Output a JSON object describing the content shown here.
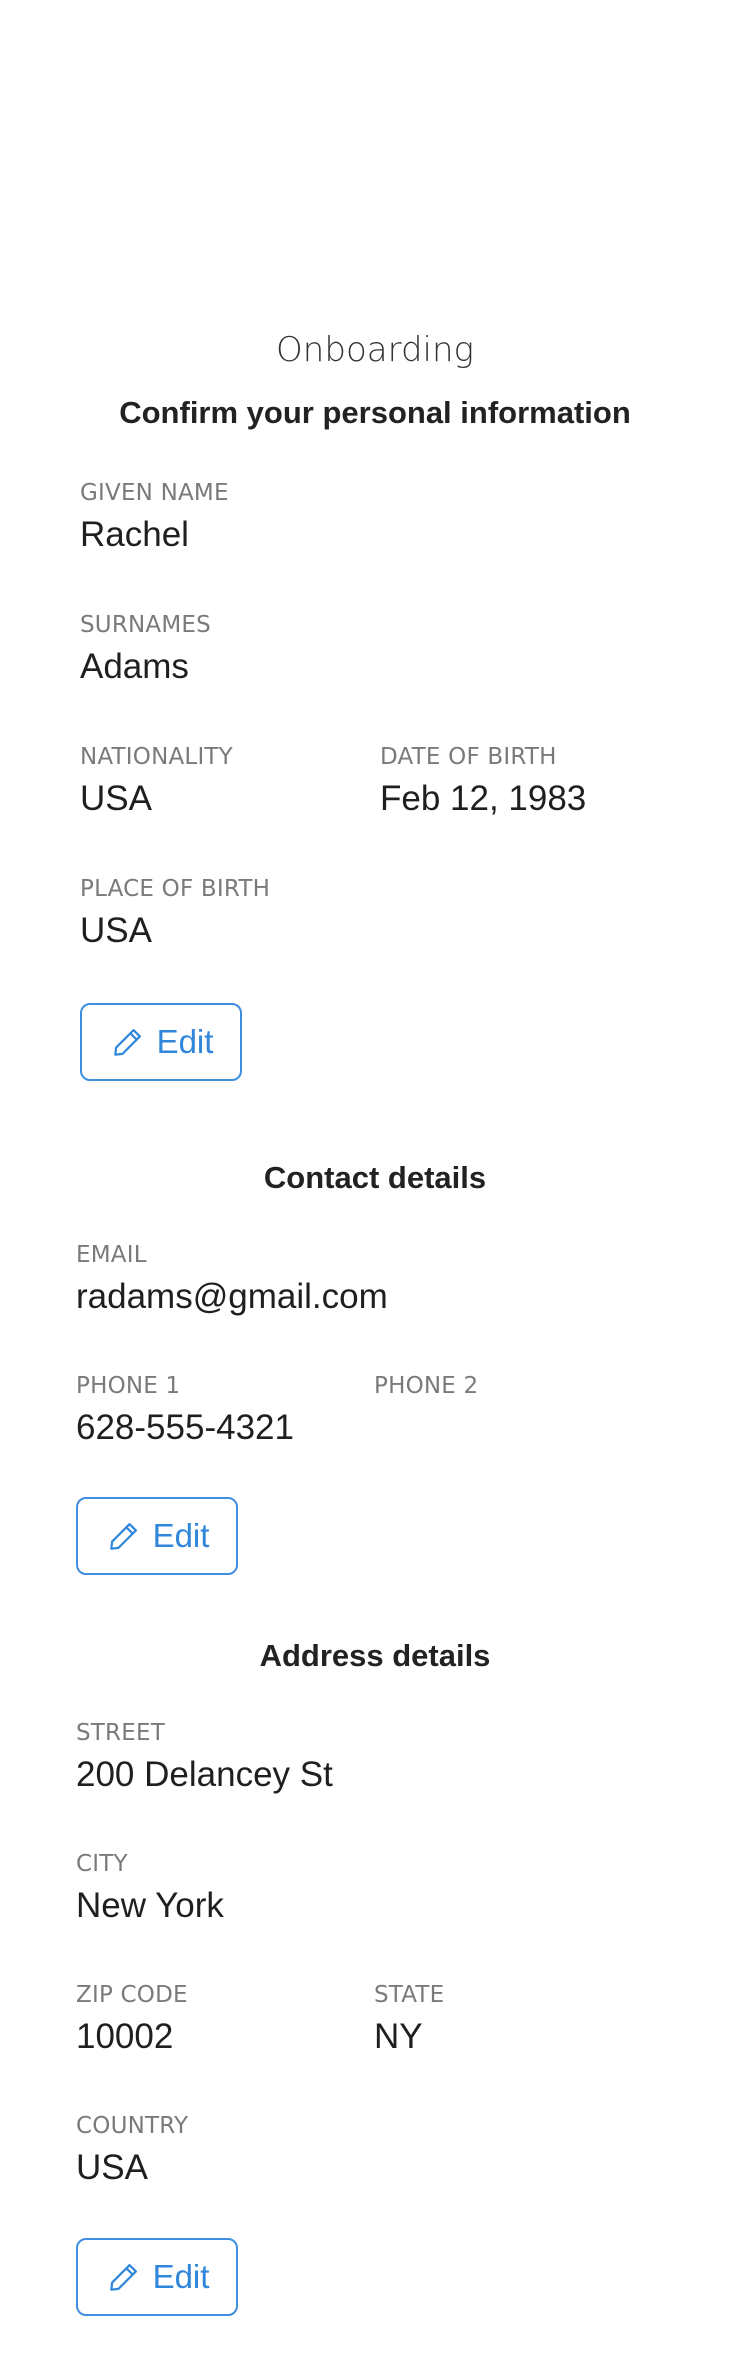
{
  "header": {
    "title": "Onboarding"
  },
  "personal": {
    "title": "Confirm your personal information",
    "given_name": {
      "label": "GIVEN NAME",
      "value": "Rachel"
    },
    "surnames": {
      "label": "SURNAMES",
      "value": "Adams"
    },
    "nationality": {
      "label": "NATIONALITY",
      "value": "USA"
    },
    "date_of_birth": {
      "label": "DATE OF BIRTH",
      "value": "Feb 12, 1983"
    },
    "place_of_birth": {
      "label": "PLACE OF BIRTH",
      "value": "USA"
    },
    "edit_label": "Edit"
  },
  "contact": {
    "title": "Contact details",
    "email": {
      "label": "EMAIL",
      "value": "radams@gmail.com"
    },
    "phone1": {
      "label": "PHONE 1",
      "value": "628-555-4321"
    },
    "phone2": {
      "label": "PHONE 2",
      "value": ""
    },
    "edit_label": "Edit"
  },
  "address": {
    "title": "Address details",
    "street": {
      "label": "STREET",
      "value": "200 Delancey St"
    },
    "city": {
      "label": "CITY",
      "value": "New York"
    },
    "zip": {
      "label": "ZIP CODE",
      "value": "10002"
    },
    "state": {
      "label": "STATE",
      "value": "NY"
    },
    "country": {
      "label": "COUNTRY",
      "value": "USA"
    },
    "edit_label": "Edit"
  },
  "colors": {
    "accent": "#2f86da",
    "label": "#7a7a7a",
    "text": "#1f1f1f"
  },
  "icons": {
    "edit": "pencil-icon"
  }
}
